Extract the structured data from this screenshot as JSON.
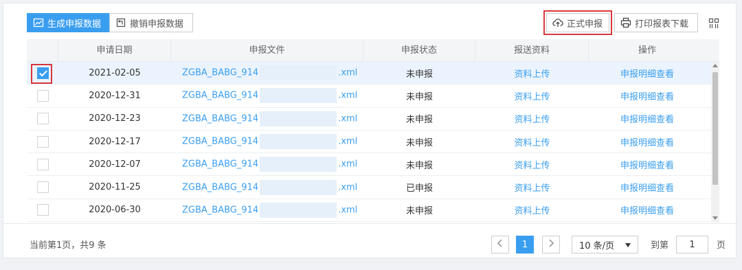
{
  "toolbar": {
    "generate_label": "生成申报数据",
    "undo_label": "撤销申报数据",
    "formal_label": "正式申报",
    "print_label": "打印报表下载"
  },
  "table": {
    "headers": [
      "申请日期",
      "申报文件",
      "申报状态",
      "报送资料",
      "操作"
    ],
    "rows": [
      {
        "date": "2021-02-05",
        "file_prefix": "ZGBA_BABG_914",
        "file_suffix": ".xml",
        "status": "未申报",
        "upload": "资料上传",
        "action": "申报明细查看",
        "checked": true
      },
      {
        "date": "2020-12-31",
        "file_prefix": "ZGBA_BABG_914",
        "file_suffix": ".xml",
        "status": "未申报",
        "upload": "资料上传",
        "action": "申报明细查看",
        "checked": false
      },
      {
        "date": "2020-12-23",
        "file_prefix": "ZGBA_BABG_914",
        "file_suffix": ".xml",
        "status": "未申报",
        "upload": "资料上传",
        "action": "申报明细查看",
        "checked": false
      },
      {
        "date": "2020-12-17",
        "file_prefix": "ZGBA_BABG_914",
        "file_suffix": ".xml",
        "status": "未申报",
        "upload": "资料上传",
        "action": "申报明细查看",
        "checked": false
      },
      {
        "date": "2020-12-07",
        "file_prefix": "ZGBA_BABG_914",
        "file_suffix": ".xml",
        "status": "未申报",
        "upload": "资料上传",
        "action": "申报明细查看",
        "checked": false
      },
      {
        "date": "2020-11-25",
        "file_prefix": "ZGBA_BABG_914",
        "file_suffix": ".xml",
        "status": "已申报",
        "upload": "资料上传",
        "action": "申报明细查看",
        "checked": false
      },
      {
        "date": "2020-06-30",
        "file_prefix": "ZGBA_BABG_914",
        "file_suffix": ".xml",
        "status": "未申报",
        "upload": "资料上传",
        "action": "申报明细查看",
        "checked": false
      }
    ]
  },
  "footer": {
    "info": "当前第1页，共9 条",
    "current_page": "1",
    "page_size": "10 条/页",
    "goto_label": "到第",
    "goto_value": "1",
    "page_unit": "页"
  },
  "colors": {
    "accent": "#3a9ef0",
    "highlight": "#d9363e"
  }
}
